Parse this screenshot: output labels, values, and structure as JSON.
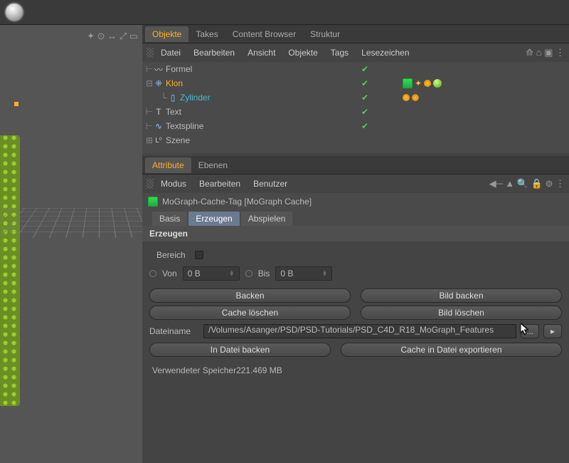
{
  "topTabs": {
    "objekte": "Objekte",
    "takes": "Takes",
    "content": "Content Browser",
    "struktur": "Struktur"
  },
  "topMenu": {
    "datei": "Datei",
    "bearbeiten": "Bearbeiten",
    "ansicht": "Ansicht",
    "objekte": "Objekte",
    "tags": "Tags",
    "lesezeichen": "Lesezeichen"
  },
  "tree": {
    "formel": "Formel",
    "klon": "Klon",
    "zylinder": "Zylinder",
    "text": "Text",
    "textspline": "Textspline",
    "szene": "Szene"
  },
  "attrTabs": {
    "attribute": "Attribute",
    "ebenen": "Ebenen"
  },
  "attrMenu": {
    "modus": "Modus",
    "bearbeiten": "Bearbeiten",
    "benutzer": "Benutzer"
  },
  "objTitle": "MoGraph-Cache-Tag [MoGraph Cache]",
  "subTabs": {
    "basis": "Basis",
    "erzeugen": "Erzeugen",
    "abspielen": "Abspielen"
  },
  "section": "Erzeugen",
  "fields": {
    "bereich": "Bereich",
    "von": "Von",
    "vonVal": "0 B",
    "bis": "Bis",
    "bisVal": "0 B",
    "dateiname": "Dateiname",
    "path": "/Volumes/Asanger/PSD/PSD-Tutorials/PSD_C4D_R18_MoGraph_Features",
    "dots": "...",
    "arrow": "▸"
  },
  "buttons": {
    "backen": "Backen",
    "bildBacken": "Bild backen",
    "cacheLoeschen": "Cache löschen",
    "bildLoeschen": "Bild löschen",
    "inDateiBacken": "In Datei backen",
    "cacheExport": "Cache in Datei exportieren"
  },
  "memory": {
    "label": "Verwendeter Speicher",
    "val": "221.469 MB"
  }
}
